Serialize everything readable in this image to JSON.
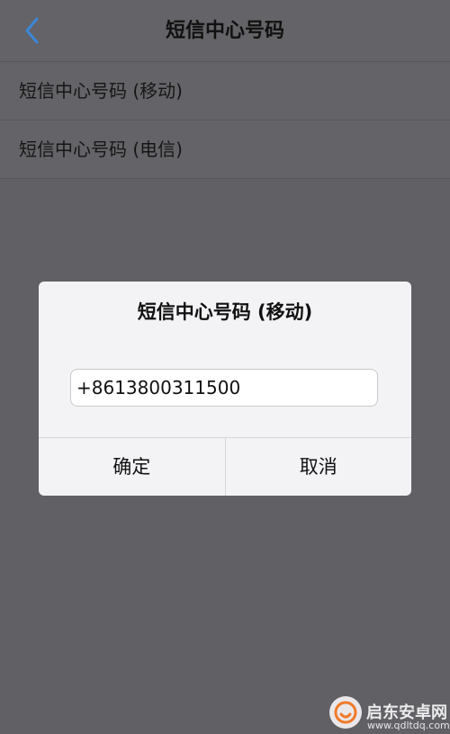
{
  "navbar": {
    "title": "短信中心号码",
    "back_icon": "chevron-left-icon"
  },
  "list": {
    "items": [
      {
        "label": "短信中心号码 (移动)"
      },
      {
        "label": "短信中心号码 (电信)"
      }
    ]
  },
  "dialog": {
    "title": "短信中心号码 (移动)",
    "input_value": "+8613800311500",
    "confirm_label": "确定",
    "cancel_label": "取消"
  },
  "watermark": {
    "main": "启东安卓网",
    "sub": "www.qdltdq.com"
  },
  "colors": {
    "accent": "#3c86d6",
    "background_dim": "#616064",
    "dialog_bg": "#f3f2f5",
    "watermark_orange": "#f07a2a"
  }
}
